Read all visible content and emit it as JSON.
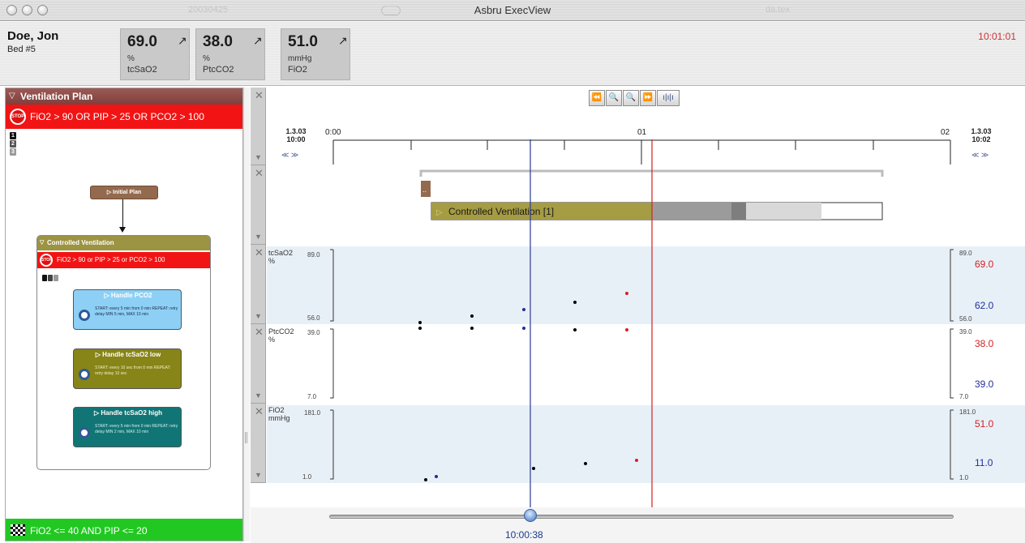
{
  "window": {
    "title": "Asbru ExecView",
    "ghost_left": "20030425",
    "ghost_right": "da.tex"
  },
  "header": {
    "patient_name": "Doe, Jon",
    "bed": "Bed #5",
    "clock": "10:01:01",
    "vitals": [
      {
        "value": "69.0",
        "trend": "↗",
        "unit": "%",
        "name": "tcSaO2"
      },
      {
        "value": "38.0",
        "trend": "↗",
        "unit": "%",
        "name": "PtcCO2"
      },
      {
        "value": "51.0",
        "trend": "↗",
        "unit": "mmHg",
        "name": "FiO2"
      }
    ]
  },
  "plan_panel": {
    "title": "Ventilation Plan",
    "stop_icon": "STOP",
    "stop_condition": "FiO2 > 90 OR PIP > 25 OR PCO2 > 100",
    "tabs": [
      "1",
      "2",
      "3"
    ],
    "initial_plan": "Initial Plan",
    "controlled_ventilation": {
      "title": "Controlled Ventilation",
      "stop_condition": "FiO2 > 90 or PIP > 25 or PCO2 > 100",
      "subplans": [
        {
          "title": "Handle PCO2",
          "desc": "START: every 5 min from 0 min REPEAT: retry delay MIN 5 min, MAX 10 min"
        },
        {
          "title": "Handle tcSaO2 low",
          "desc": "START: every 10 sec from 0 min REPEAT: retry delay 10 sec"
        },
        {
          "title": "Handle tcSaO2 high",
          "desc": "START: every 5 min from 0 min REPEAT: retry delay MIN 2 min, MAX 10 min"
        }
      ]
    },
    "goal_condition": "FiO2 <= 40 AND PIP <= 20"
  },
  "timeline": {
    "toolbar": [
      "⏪",
      "🔍",
      "🔍",
      "⏩",
      "ı|ı|ı"
    ],
    "start_date": "1.3.03",
    "start_time": "10:00",
    "end_date": "1.3.03",
    "end_time": "10:02",
    "nav_left": "≪  ≫",
    "nav_right": "≪  ≫",
    "tick_labels": [
      "0:00",
      "01",
      "02"
    ],
    "plan_bar_label": "Controlled Ventilation [1]",
    "plan_stub_label": ".."
  },
  "rows": [
    {
      "name": "tcSaO2",
      "unit": "%",
      "max": "89.0",
      "min": "56.0",
      "right_max": "89.0",
      "right_min": "56.0",
      "value_red": "69.0",
      "value_blue": "62.0"
    },
    {
      "name": "PtcCO2",
      "unit": "%",
      "max": "39.0",
      "min": "7.0",
      "right_max": "39.0",
      "right_min": "7.0",
      "value_red": "38.0",
      "value_blue": "39.0"
    },
    {
      "name": "FiO2",
      "unit": "mmHg",
      "max": "181.0",
      "min": "1.0",
      "right_max": "181.0",
      "right_min": "1.0",
      "value_red": "51.0",
      "value_blue": "11.0"
    }
  ],
  "slider": {
    "time": "10:00:38"
  },
  "colors": {
    "red": "#d42020",
    "blue": "#1f2f9a",
    "goal": "#22c822",
    "stop": "#f21414"
  }
}
